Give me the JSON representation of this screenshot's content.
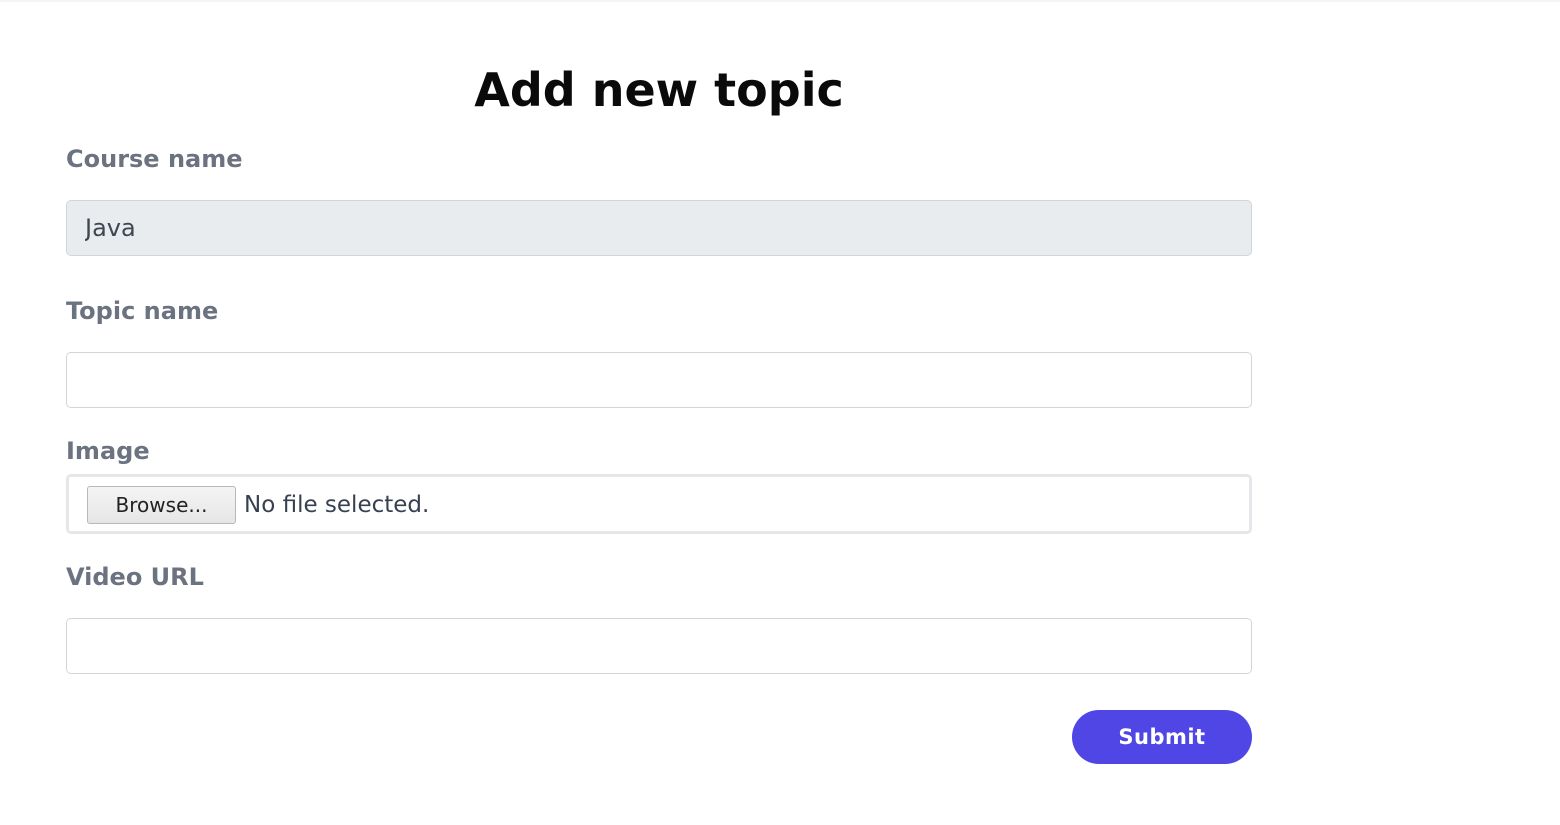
{
  "page": {
    "title": "Add new topic"
  },
  "form": {
    "course_name": {
      "label": "Course name",
      "value": "Java"
    },
    "topic_name": {
      "label": "Topic name",
      "value": "",
      "placeholder": ""
    },
    "image": {
      "label": "Image",
      "browse_label": "Browse...",
      "status": "No file selected."
    },
    "video_url": {
      "label": "Video URL",
      "value": "",
      "placeholder": ""
    },
    "submit_label": "Submit"
  },
  "colors": {
    "accent": "#4f46e5",
    "label": "#6b7280",
    "readonly_bg": "#e9ecef"
  }
}
